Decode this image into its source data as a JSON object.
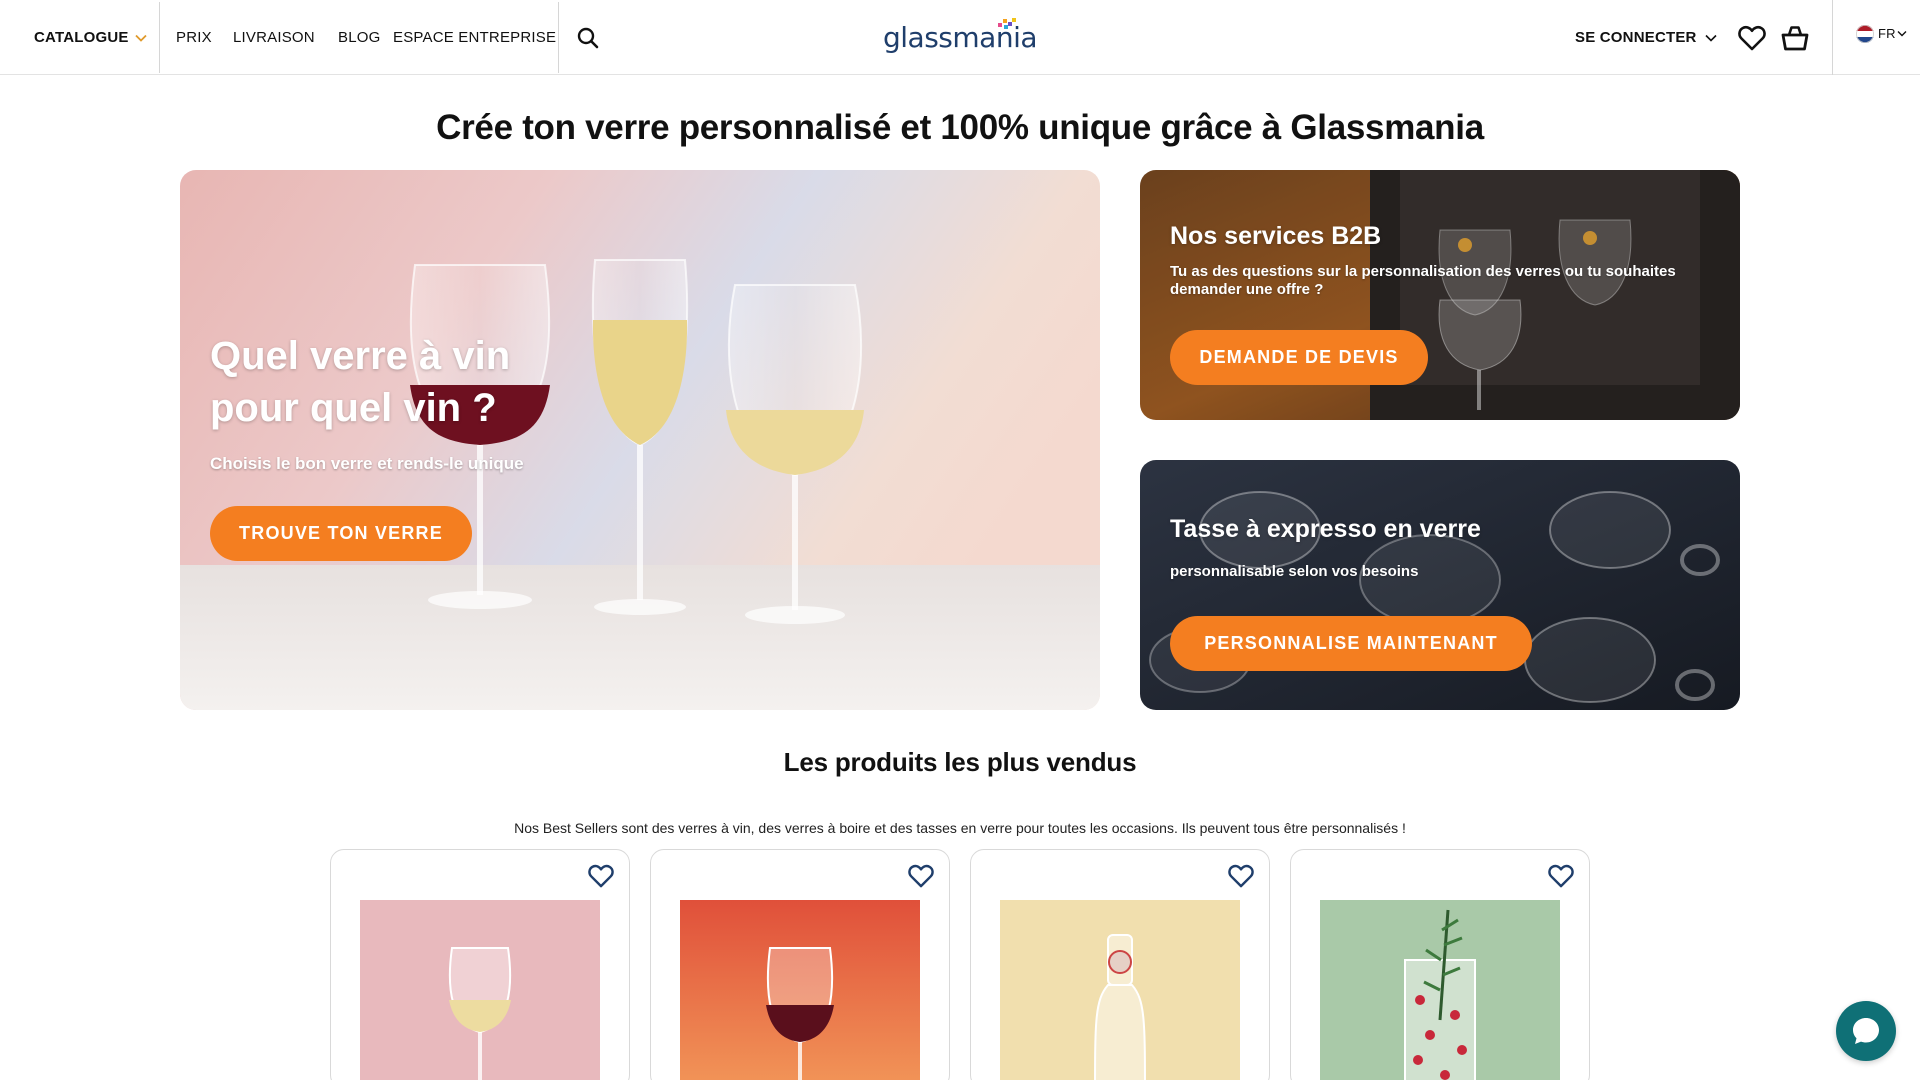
{
  "header": {
    "nav": {
      "catalogue": "CATALOGUE",
      "prix": "PRIX",
      "livraison": "LIVRAISON",
      "blog": "BLOG",
      "espace_entreprise": "ESPACE ENTREPRISE"
    },
    "logo": "glassmania",
    "login": "SE CONNECTER",
    "language": "FR"
  },
  "hero": {
    "title": "Crée ton verre personnalisé et 100% unique grâce à Glassmania"
  },
  "banners": {
    "main": {
      "title_line1": "Quel verre à vin",
      "title_line2": "pour quel vin ?",
      "subtitle": "Choisis le bon verre et rends-le unique",
      "cta": "TROUVE TON VERRE"
    },
    "b2b": {
      "title": "Nos services B2B",
      "subtitle": "Tu as des questions sur la personnalisation des verres ou tu souhaites demander une offre ?",
      "cta": "DEMANDE DE DEVIS"
    },
    "espresso": {
      "title": "Tasse à expresso en verre",
      "subtitle": "personnalisable selon vos besoins",
      "cta": "PERSONNALISE MAINTENANT"
    }
  },
  "bestsellers": {
    "title": "Les produits les plus vendus",
    "description": "Nos Best Sellers sont des verres à vin, des verres à boire et des tasses en verre pour toutes les occasions. Ils peuvent tous être personnalisés !"
  },
  "colors": {
    "accent": "#f47e20",
    "chat": "#0f7076",
    "logo": "#1f3e6b"
  }
}
